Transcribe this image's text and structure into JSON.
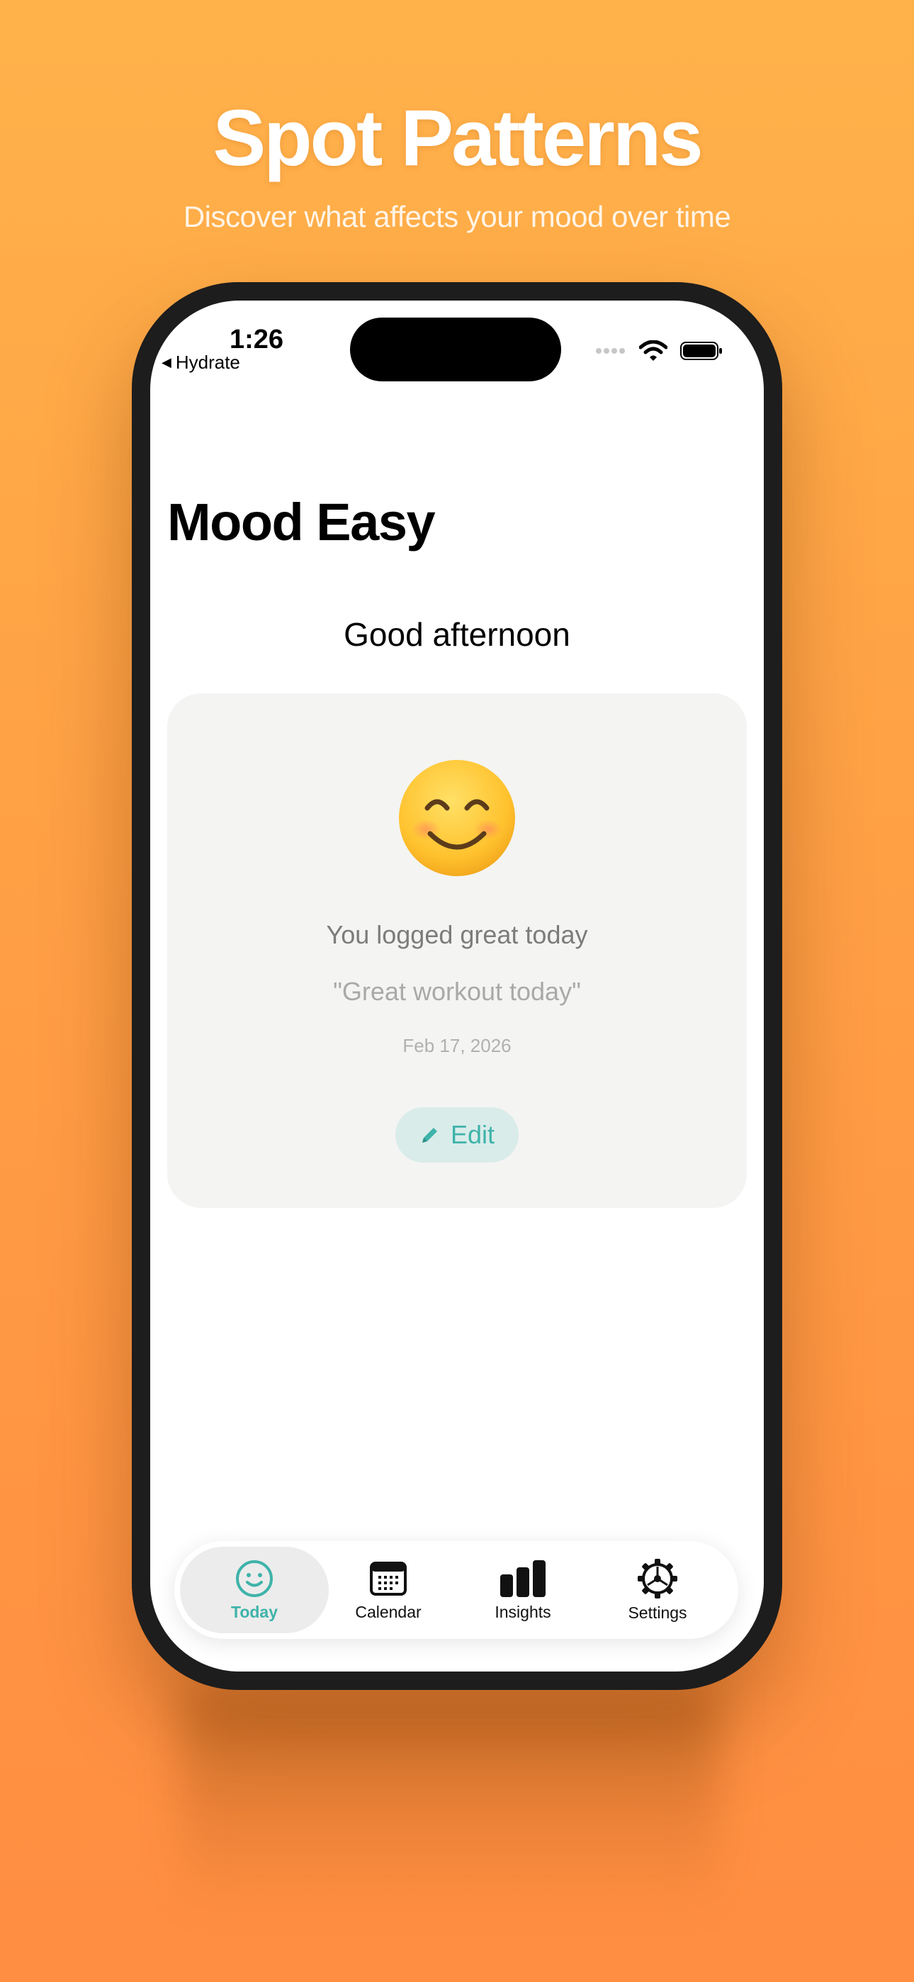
{
  "promo": {
    "headline": "Spot Patterns",
    "subhead": "Discover what affects your mood over time"
  },
  "status_bar": {
    "time": "1:26",
    "back_app": "Hydrate"
  },
  "app": {
    "title": "Mood Easy",
    "greeting": "Good afternoon"
  },
  "mood_card": {
    "emoji_icon": "smiling-face-icon",
    "logged_text": "You logged great today",
    "note": "\"Great workout today\"",
    "date": "Feb 17, 2026",
    "edit_label": "Edit"
  },
  "tabs": [
    {
      "label": "Today",
      "icon": "smiley-icon",
      "active": true
    },
    {
      "label": "Calendar",
      "icon": "calendar-icon",
      "active": false
    },
    {
      "label": "Insights",
      "icon": "bar-chart-icon",
      "active": false
    },
    {
      "label": "Settings",
      "icon": "gear-icon",
      "active": false
    }
  ],
  "colors": {
    "accent": "#3fb3aa",
    "background_top": "#ffb24a",
    "background_bottom": "#ff8d42"
  }
}
